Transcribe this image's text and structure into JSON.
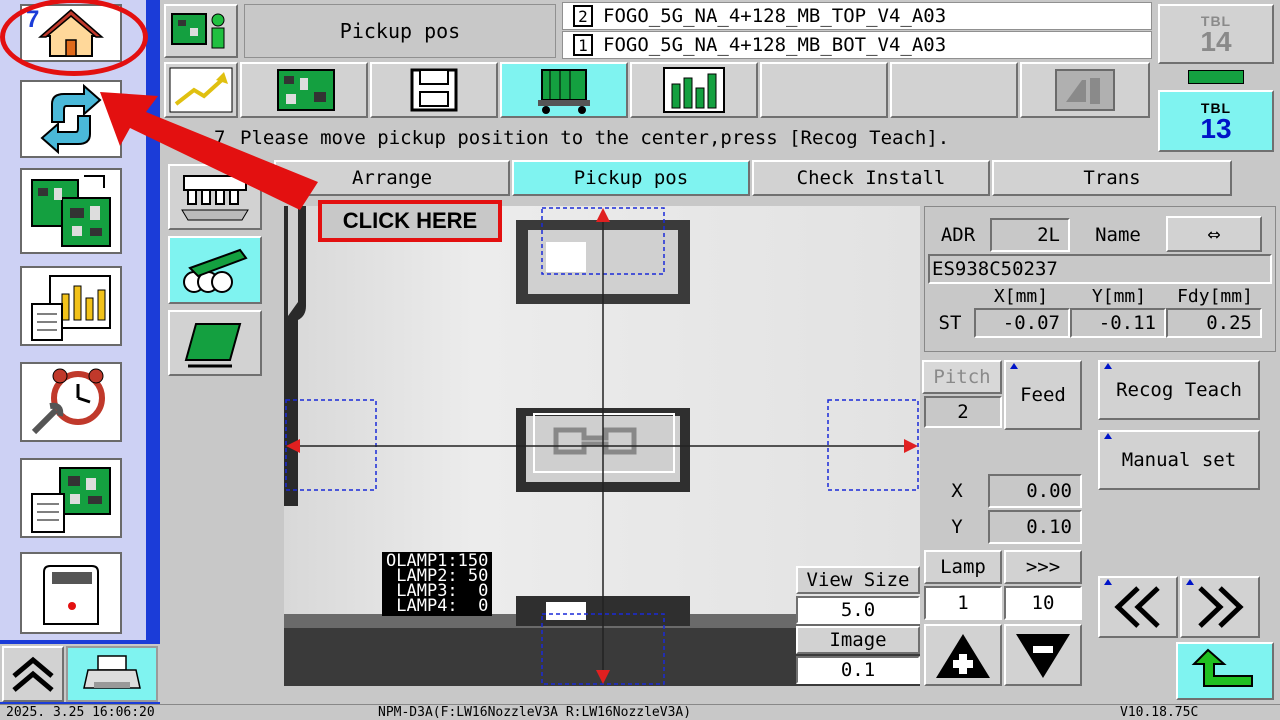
{
  "header": {
    "mode_title": "Pickup pos",
    "program_top_index": "2",
    "program_top": "FOGO_5G_NA_4+128_MB_TOP_V4_A03",
    "program_bot_index": "1",
    "program_bot": "FOGO_5G_NA_4+128_MB_BOT_V4_A03",
    "tbl_label": "TBL",
    "tbl_upper_num": "14",
    "tbl_lower_num": "13"
  },
  "message": {
    "prefix": "7",
    "text": "Please move pickup position to the center,press [Recog Teach]."
  },
  "home_badge": "7",
  "tabs": [
    {
      "label": "Arrange"
    },
    {
      "label": "Pickup pos"
    },
    {
      "label": "Check Install"
    },
    {
      "label": "Trans"
    }
  ],
  "annotation": {
    "callout": "CLICK HERE"
  },
  "camera": {
    "lamp_overlay": [
      {
        "label": "OLAMP1:",
        "value": "150"
      },
      {
        "label": "LAMP2:",
        "value": "50"
      },
      {
        "label": "LAMP3:",
        "value": "0"
      },
      {
        "label": "LAMP4:",
        "value": "0"
      }
    ]
  },
  "view_size": {
    "label": "View Size",
    "value": "5.0"
  },
  "image": {
    "label": "Image",
    "value": "0.1"
  },
  "info": {
    "adr_label": "ADR",
    "adr_value": "2L",
    "name_label": "Name",
    "swap_symbol": "⇔",
    "part_name": "ES938C50237",
    "col_x": "X[mm]",
    "col_y": "Y[mm]",
    "col_fdy": "Fdy[mm]",
    "st_label": "ST",
    "st_x": "-0.07",
    "st_y": "-0.11",
    "st_fdy": "0.25"
  },
  "controls": {
    "pitch_label": "Pitch",
    "pitch_value": "2",
    "feed_label": "Feed",
    "recog_teach_label": "Recog Teach",
    "manual_set_label": "Manual set",
    "x_label": "X",
    "x_value": "0.00",
    "y_label": "Y",
    "y_value": "0.10",
    "lamp_label": "Lamp",
    "lamp_next_label": ">>>",
    "lamp_value": "1",
    "lamp_level": "10"
  },
  "status_bar": {
    "datetime": "2025. 3.25 16:06:20",
    "machine": "NPM-D3A(F:LW16NozzleV3A  R:LW16NozzleV3A)",
    "version": "V10.18.75C"
  },
  "colors": {
    "accent_cyan": "#7ff3f0",
    "annotation_red": "#e31010",
    "sidebar_blue": "#1b3cd8",
    "board_green": "#14a040"
  }
}
